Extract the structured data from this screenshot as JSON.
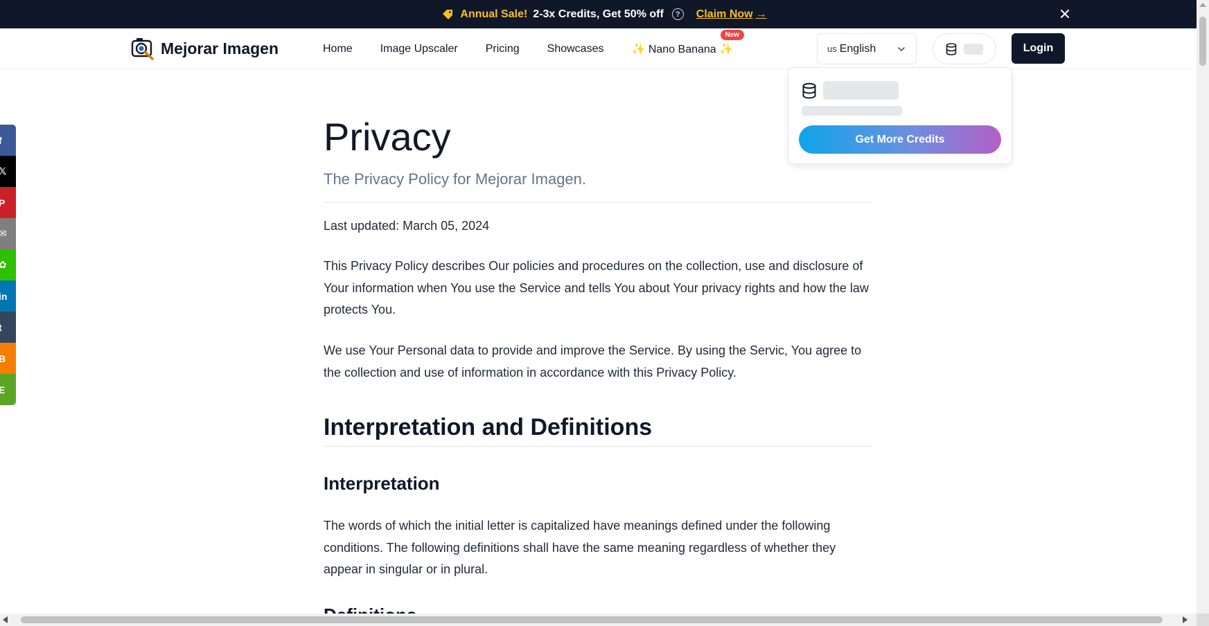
{
  "promo": {
    "sale_label": "Annual Sale!",
    "offer": "2-3x Credits, Get 50% off",
    "help_glyph": "?",
    "claim_label": "Claim Now",
    "claim_arrow": "→"
  },
  "header": {
    "brand": "Mejorar Imagen",
    "nav": [
      "Home",
      "Image Upscaler",
      "Pricing",
      "Showcases",
      "✨ Nano Banana ✨"
    ],
    "new_badge": "New",
    "language": {
      "flag": "us",
      "label": "English"
    },
    "login_label": "Login"
  },
  "credits_dropdown": {
    "cta_label": "Get More Credits"
  },
  "share_bar": [
    {
      "glyph": "f",
      "color": "#3b5998",
      "icon": "facebook-icon"
    },
    {
      "glyph": "𝕏",
      "color": "#000000",
      "icon": "x-icon"
    },
    {
      "glyph": "P",
      "color": "#cb2027",
      "icon": "pinterest-icon"
    },
    {
      "glyph": "✉",
      "color": "#7f7f7f",
      "icon": "email-icon"
    },
    {
      "glyph": "✿",
      "color": "#2dc100",
      "icon": "wechat-icon"
    },
    {
      "glyph": "in",
      "color": "#0077b5",
      "icon": "linkedin-icon"
    },
    {
      "glyph": "t",
      "color": "#35465c",
      "icon": "tumblr-icon"
    },
    {
      "glyph": "B",
      "color": "#f57d00",
      "icon": "blogger-icon"
    },
    {
      "glyph": "E",
      "color": "#5ba525",
      "icon": "evernote-icon"
    }
  ],
  "content": {
    "title": "Privacy",
    "subtitle": "The Privacy Policy for Mejorar Imagen.",
    "last_updated": "Last updated: March 05, 2024",
    "paragraph_1": "This Privacy Policy describes Our policies and procedures on the collection, use and disclosure of Your information when You use the Service and tells You about Your privacy rights and how the law protects You.",
    "paragraph_2": "We use Your Personal data to provide and improve the Service. By using the Servic, You agree to the collection and use of information in accordance with this Privacy Policy.",
    "heading_2": "Interpretation and Definitions",
    "heading_3": "Interpretation",
    "paragraph_3": "The words of which the initial letter is capitalized have meanings defined under the following conditions. The following definitions shall have the same meaning regardless of whether they appear in singular or in plural.",
    "heading_3b": "Definitions"
  }
}
